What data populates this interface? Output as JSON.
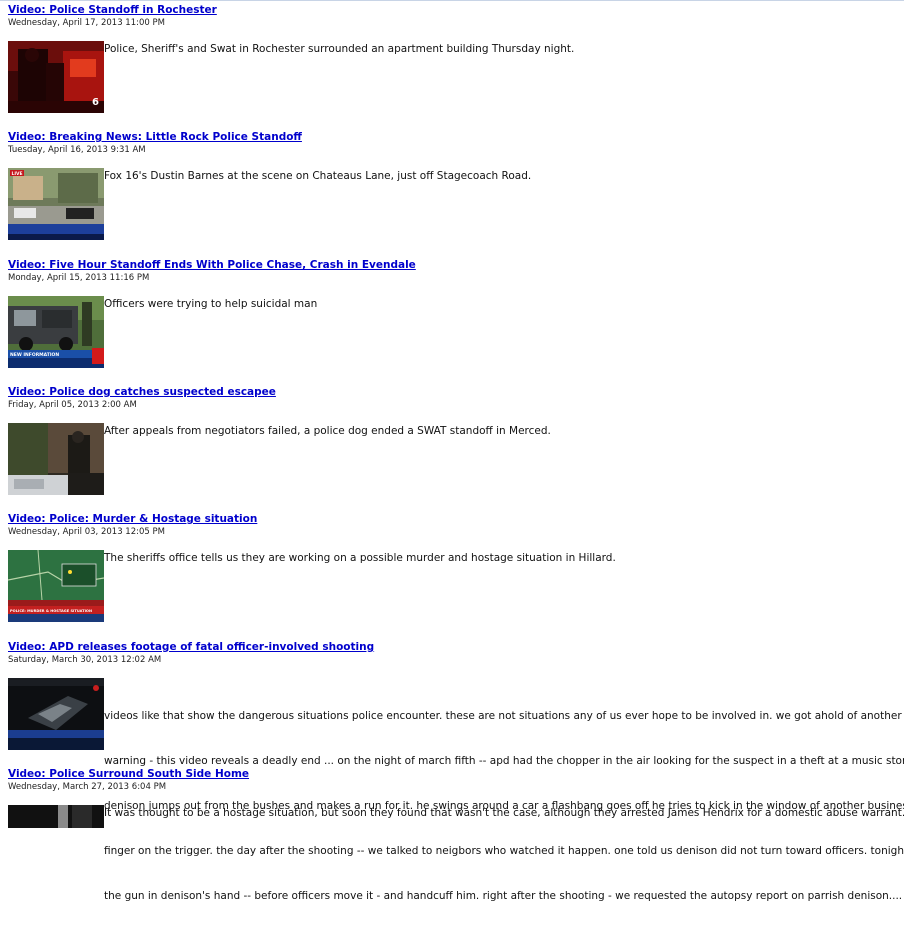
{
  "items": [
    {
      "title": "Video: Police Standoff in Rochester",
      "date": "Wednesday, April 17, 2013 11:00 PM",
      "description": "Police, Sheriff's and Swat in Rochester surrounded an apartment building Thursday night.",
      "thumb_badge": "6"
    },
    {
      "title": "Video: Breaking News: Little Rock Police Standoff",
      "date": "Tuesday, April 16, 2013 9:31 AM",
      "description": "Fox 16's Dustin Barnes at the scene on Chateaus Lane, just off Stagecoach Road.",
      "thumb_badge": "LIVE"
    },
    {
      "title": "Video: Five Hour Standoff Ends With Police Chase, Crash in Evendale",
      "date": "Monday, April 15, 2013 11:16 PM",
      "description": "Officers were trying to help suicidal man",
      "thumb_badge": "NEW INFORMATION"
    },
    {
      "title": "Video: Police dog catches suspected escapee",
      "date": "Friday, April 05, 2013 2:00 AM",
      "description": "After appeals from negotiators failed, a police dog ended a SWAT standoff in Merced.",
      "thumb_badge": ""
    },
    {
      "title": "Video: Police: Murder & Hostage situation",
      "date": "Wednesday, April 03, 2013 12:05 PM",
      "description": "The sheriffs office tells us they are working on a possible murder and hostage situation in Hillard.",
      "thumb_badge": "POLICE: MURDER & HOSTAGE SITUATION"
    },
    {
      "title": "Video: APD releases footage of fatal officer-involved shooting",
      "date": "Saturday, March 30, 2013 12:02 AM",
      "description_lines": [
        "videos like that show the dangerous situations police encounter. these are not situations any of us ever hope to be involved in. we got ahold of another video",
        "warning - this video reveals a deadly end ... on the night of march fifth -- apd had the chopper in the air looking for the suspect in a theft at a music store on",
        "denison jumps out from the bushes and makes a run for it. he swings around a car a flashbang goes off he tries to kick in the window of another business.",
        "finger on the trigger. the day after the shooting -- we talked to neigbors who watched it happen. one told us denison did not turn toward officers. tonight",
        "the gun in denison's hand -- before officers move it - and handcuff him. right after the shooting - we requested the autopsy report on parrish denison.... w"
      ],
      "thumb_badge": ""
    },
    {
      "title": "Video: Police Surround South Side Home",
      "date": "Wednesday, March 27, 2013 6:04 PM",
      "description": "It was thought to be a hostage situation, but soon they found that wasn't the case, although they arrested James Hendrix for a domestic abuse warrant.",
      "thumb_badge": ""
    }
  ]
}
